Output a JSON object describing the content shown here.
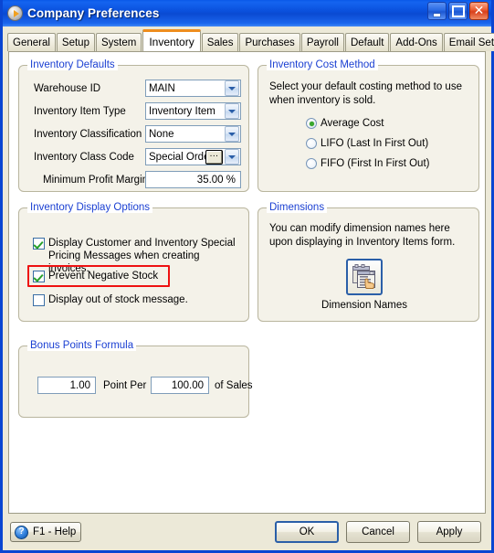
{
  "window": {
    "title": "Company Preferences",
    "icon": "app-play-icon",
    "buttons": {
      "minimize": "minimize-icon",
      "maximize": "maximize-icon",
      "close": "✕"
    }
  },
  "tabs": [
    {
      "label": "General",
      "active": false
    },
    {
      "label": "Setup",
      "active": false
    },
    {
      "label": "System",
      "active": false
    },
    {
      "label": "Inventory",
      "active": true
    },
    {
      "label": "Sales",
      "active": false
    },
    {
      "label": "Purchases",
      "active": false
    },
    {
      "label": "Payroll",
      "active": false
    },
    {
      "label": "Default",
      "active": false
    },
    {
      "label": "Add-Ons",
      "active": false
    },
    {
      "label": "Email Setup",
      "active": false
    }
  ],
  "inventory_defaults": {
    "legend": "Inventory Defaults",
    "warehouse_id": {
      "label": "Warehouse ID",
      "value": "MAIN"
    },
    "item_type": {
      "label": "Inventory Item Type",
      "value": "Inventory Item"
    },
    "classification": {
      "label": "Inventory Classification",
      "value": "None"
    },
    "class_code": {
      "label": "Inventory Class Code",
      "value": "Special Order",
      "lookup": "..."
    },
    "min_profit_margin": {
      "label": "Minimum Profit Margin",
      "value": "35.00 %"
    }
  },
  "cost_method": {
    "legend": "Inventory Cost Method",
    "description": "Select your default costing method to use when inventory is sold.",
    "options": [
      {
        "label": "Average Cost",
        "selected": true
      },
      {
        "label": "LIFO (Last In First Out)",
        "selected": false
      },
      {
        "label": "FIFO (First In First Out)",
        "selected": false
      }
    ]
  },
  "display_options": {
    "legend": "Inventory Display Options",
    "items": [
      {
        "label": "Display Customer and Inventory Special Pricing Messages when creating invoices.",
        "checked": true,
        "highlighted": false
      },
      {
        "label": "Prevent Negative Stock",
        "checked": true,
        "highlighted": true
      },
      {
        "label": "Display out of stock message.",
        "checked": false,
        "highlighted": false
      }
    ],
    "highlight_color": "#ee1111"
  },
  "dimensions": {
    "legend": "Dimensions",
    "description": "You can modify dimension names here upon displaying in Inventory Items form.",
    "button_caption": "Dimension Names",
    "button_icon": "dimension-names-icon"
  },
  "bonus_points": {
    "legend": "Bonus Points Formula",
    "points_value": "1.00",
    "middle_label": "Point Per",
    "amount_value": "100.00",
    "trailing_label": "of Sales"
  },
  "footer": {
    "help": "F1 - Help",
    "help_icon": "?",
    "ok": "OK",
    "cancel": "Cancel",
    "apply": "Apply"
  },
  "colors": {
    "titlebar": "#0a50dc",
    "legend_text": "#1a3fd2",
    "active_tab_accent": "#ef8e1e",
    "check_green": "#27a02a",
    "radio_green": "#3aa82b",
    "highlight_red": "#ee1111"
  }
}
